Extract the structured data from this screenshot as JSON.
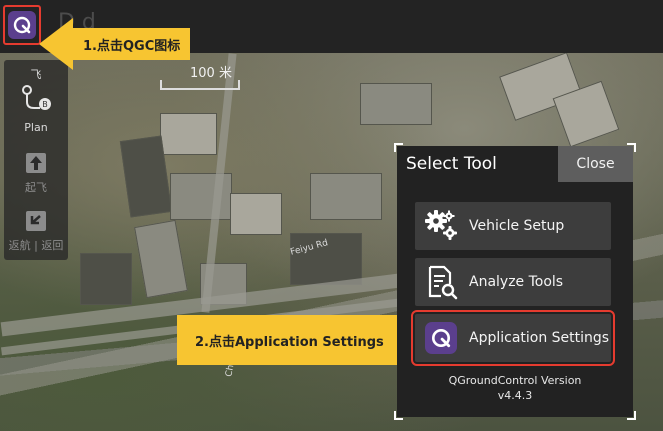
{
  "topbar": {
    "title": "D            d"
  },
  "left_toolbar": {
    "items": [
      {
        "label": "飞",
        "icon": "fly-icon"
      },
      {
        "label": "Plan",
        "icon": "plan-route-icon"
      },
      {
        "label": "起飞",
        "icon": "takeoff-icon"
      },
      {
        "label": "返航 | 返回",
        "icon": "return-icon"
      }
    ]
  },
  "map": {
    "scale_label": "100 米",
    "road_label_1": "Feiyu Rd",
    "road_label_2": "Chu"
  },
  "callouts": {
    "step1": "1.点击QGC图标",
    "step2": "2.点击Application Settings"
  },
  "dialog": {
    "title": "Select Tool",
    "close_label": "Close",
    "buttons": [
      {
        "label": "Vehicle Setup",
        "icon": "gears-icon"
      },
      {
        "label": "Analyze Tools",
        "icon": "analyze-document-icon"
      },
      {
        "label": "Application Settings",
        "icon": "qgc-logo-icon"
      }
    ],
    "version_label": "QGroundControl Version",
    "version_value": "v4.4.3"
  },
  "colors": {
    "highlight": "#e53b2f",
    "callout": "#f7c531",
    "qgc_purple": "#5b3f8d"
  }
}
